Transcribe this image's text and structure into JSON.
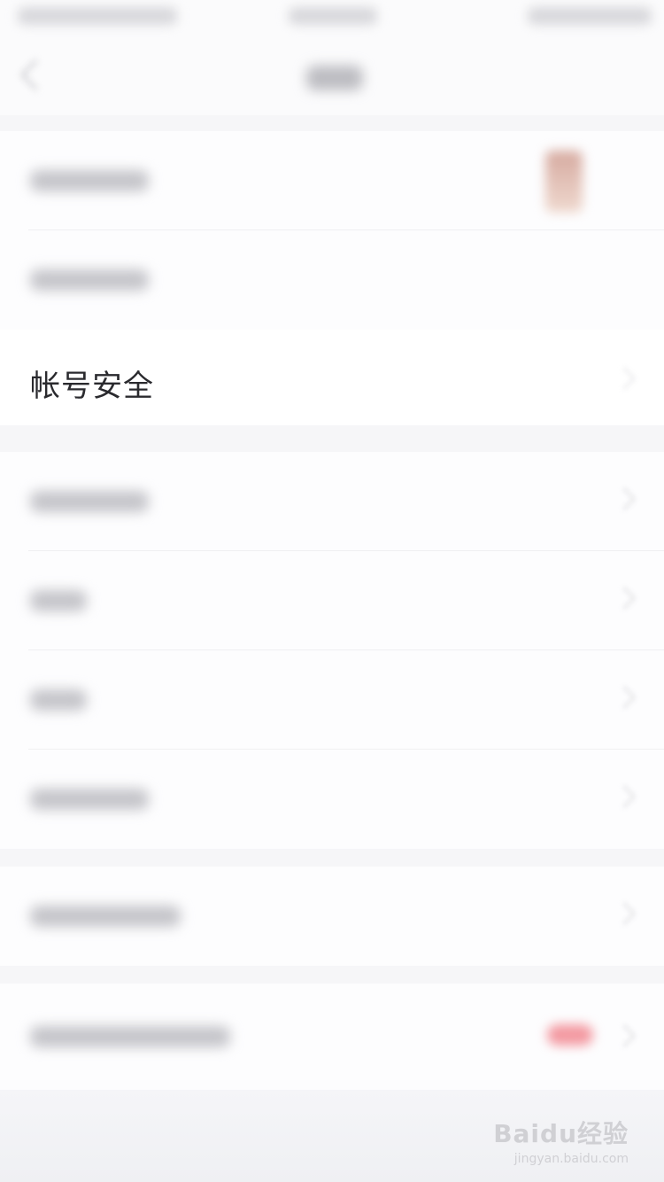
{
  "account_security_row": {
    "label": "帐号安全"
  },
  "watermark": {
    "brand": "Baidu经验",
    "url": "jingyan.baidu.com"
  }
}
